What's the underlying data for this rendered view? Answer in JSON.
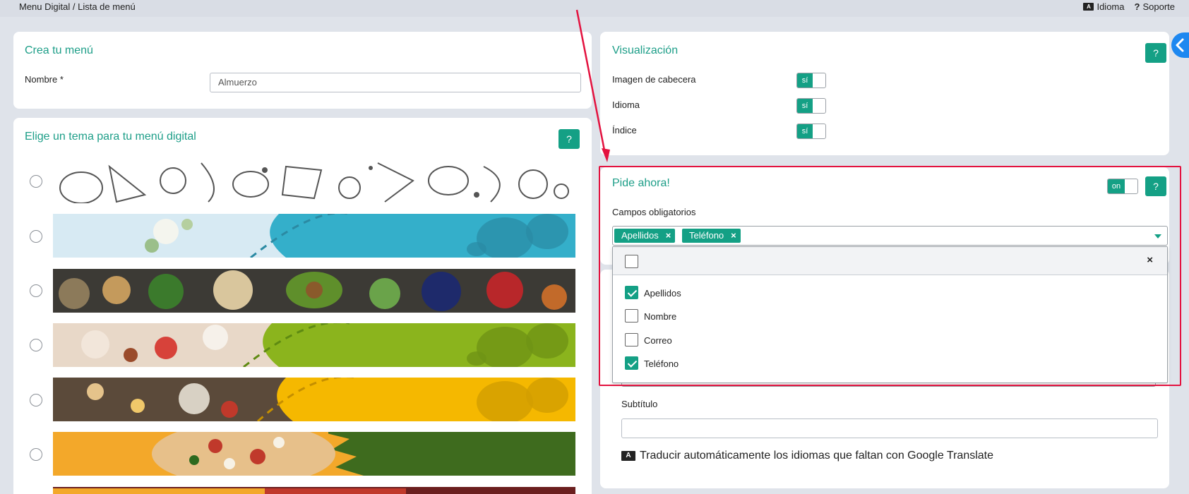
{
  "topbar": {
    "breadcrumb": "Menu Digital / Lista de menú",
    "language_label": "Idioma",
    "support_label": "Soporte"
  },
  "create_menu": {
    "title": "Crea tu menú",
    "name_label": "Nombre *",
    "name_value": "Almuerzo"
  },
  "theme": {
    "title": "Elige un tema para tu menú digital",
    "help_label": "?",
    "themes": [
      {
        "name": "sketch-food"
      },
      {
        "name": "light-blue-flowers"
      },
      {
        "name": "ingredients-spread"
      },
      {
        "name": "green-table"
      },
      {
        "name": "yellow-restaurant"
      },
      {
        "name": "pizza-green"
      },
      {
        "name": "dark-red-partial"
      }
    ]
  },
  "visualization": {
    "title": "Visualización",
    "help_label": "?",
    "rows": [
      {
        "label": "Imagen de cabecera",
        "toggle": "sí"
      },
      {
        "label": "Idioma",
        "toggle": "sí"
      },
      {
        "label": "Índice",
        "toggle": "sí"
      }
    ]
  },
  "order_now": {
    "title": "Pide ahora!",
    "toggle": "on",
    "help_label": "?",
    "required_fields_label": "Campos obligatorios",
    "selected_tags": [
      "Apellidos",
      "Teléfono"
    ],
    "dropdown": {
      "close_label": "×",
      "options": [
        {
          "label": "Apellidos",
          "checked": true
        },
        {
          "label": "Nombre",
          "checked": false
        },
        {
          "label": "Correo",
          "checked": false
        },
        {
          "label": "Teléfono",
          "checked": true
        }
      ]
    }
  },
  "below": {
    "subtitle_label": "Subtítulo",
    "translate_text": "Traducir automáticamente los idiomas que faltan con Google Translate"
  },
  "colors": {
    "accent": "#14a085",
    "highlight": "#e3123f",
    "side_tab": "#1e88f0"
  }
}
